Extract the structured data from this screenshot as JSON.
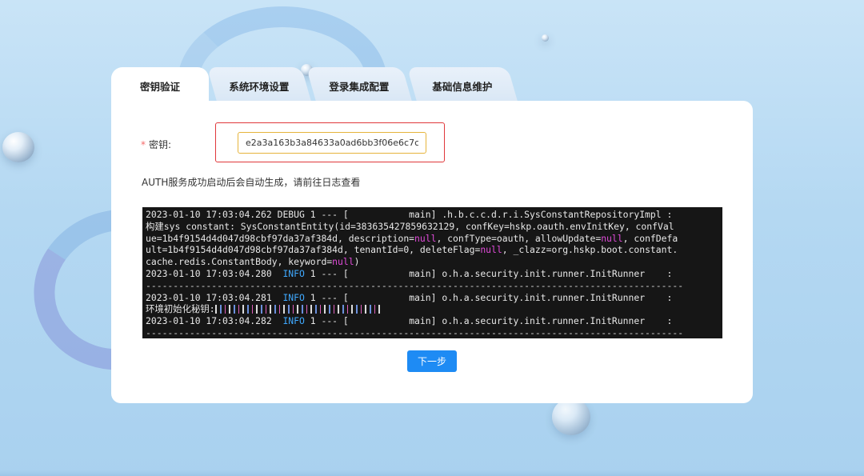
{
  "tabs": [
    {
      "label": "密钥验证",
      "active": true
    },
    {
      "label": "系统环境设置",
      "active": false
    },
    {
      "label": "登录集成配置",
      "active": false
    },
    {
      "label": "基础信息维护",
      "active": false
    }
  ],
  "form": {
    "required_mark": "*",
    "key_label": "密钥:",
    "key_value": "e2a3a163b3a84633a0ad6bb3f06e6c7c",
    "hint": "AUTH服务成功启动后会自动生成，请前往日志查看"
  },
  "log": {
    "lines": [
      {
        "parts": [
          {
            "t": "2023-01-10 17:03:04.262 DEBUG 1 --- [           main] .h.b.c.c.d.r.i.SysConstantRepositoryImpl :"
          }
        ]
      },
      {
        "parts": [
          {
            "t": "构建sys constant: SysConstantEntity(id=383635427859632129, confKey=hskp.oauth.envInitKey, confVal"
          }
        ]
      },
      {
        "parts": [
          {
            "t": "ue=1b4f9154d4d047d98cbf97da37af384d, description="
          },
          {
            "t": "null",
            "c": "kw"
          },
          {
            "t": ", confType=oauth, allowUpdate="
          },
          {
            "t": "null",
            "c": "kw"
          },
          {
            "t": ", confDefa"
          }
        ]
      },
      {
        "parts": [
          {
            "t": "ult=1b4f9154d4d047d98cbf97da37af384d, tenantId=0, deleteFlag="
          },
          {
            "t": "null",
            "c": "kw"
          },
          {
            "t": ", _clazz=org.hskp.boot.constant."
          }
        ]
      },
      {
        "parts": [
          {
            "t": "cache.redis.ConstantBody, keyword="
          },
          {
            "t": "null",
            "c": "kw"
          },
          {
            "t": ")"
          }
        ]
      },
      {
        "parts": [
          {
            "t": "2023-01-10 17:03:04.280  "
          },
          {
            "t": "INFO",
            "c": "info"
          },
          {
            "t": " 1 --- [           main] o.h.a.security.init.runner.InitRunner    :"
          }
        ]
      },
      {
        "parts": [
          {
            "t": "--------------------------------------------------------------------------------------------------",
            "c": "dash"
          }
        ]
      },
      {
        "parts": [
          {
            "t": "2023-01-10 17:03:04.281  "
          },
          {
            "t": "INFO",
            "c": "info"
          },
          {
            "t": " 1 --- [           main] o.h.a.security.init.runner.InitRunner    :"
          }
        ]
      },
      {
        "parts": [
          {
            "t": "环境初始化秘钥:"
          },
          {
            "t": "",
            "c": "pix"
          }
        ]
      },
      {
        "parts": [
          {
            "t": "2023-01-10 17:03:04.282  "
          },
          {
            "t": "INFO",
            "c": "info"
          },
          {
            "t": " 1 --- [           main] o.h.a.security.init.runner.InitRunner    :"
          }
        ]
      },
      {
        "parts": [
          {
            "t": "--------------------------------------------------------------------------------------------------",
            "c": "dash"
          }
        ]
      }
    ]
  },
  "actions": {
    "next_label": "下一步"
  },
  "colors": {
    "primary": "#1e8bf4",
    "danger_outline": "#e0383b",
    "input_focus": "#e6b43c",
    "log_info": "#3fa9ff",
    "log_null": "#e04bd9"
  }
}
